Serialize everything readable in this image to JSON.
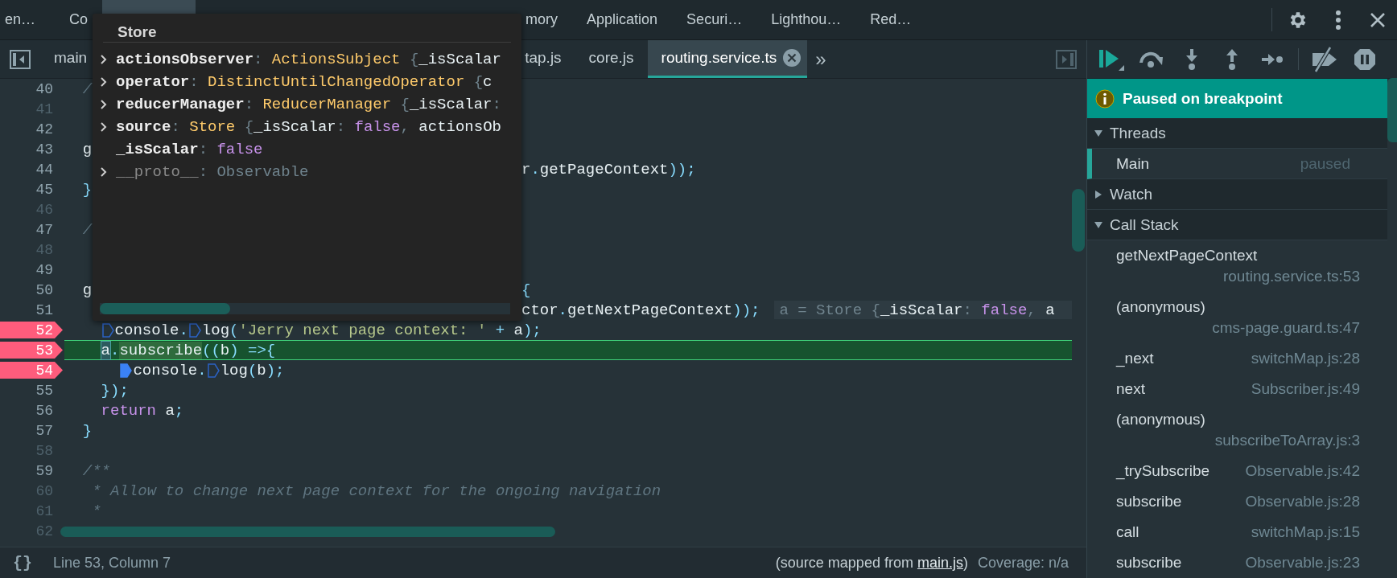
{
  "panel_tabs": [
    {
      "label": "en…",
      "selected": false
    },
    {
      "label": "Co",
      "selected": false
    },
    {
      "selected": true
    },
    {
      "label": "mory",
      "selected": false
    },
    {
      "label": "Application",
      "selected": false
    },
    {
      "label": "Securi…",
      "selected": false
    },
    {
      "label": "Lighthou…",
      "selected": false
    },
    {
      "label": "Red…",
      "selected": false
    }
  ],
  "file_tabs": [
    {
      "label": "main",
      "selected": false
    },
    {
      "label": "tap.js",
      "selected": false
    },
    {
      "label": "core.js",
      "selected": false
    },
    {
      "label": "routing.service.ts",
      "selected": true
    }
  ],
  "more_tabs": "»",
  "hover_popup": {
    "title": "Store",
    "properties": [
      {
        "name": "actionsObserver",
        "expandable": true,
        "dim": false,
        "value": [
          {
            "text": ": ",
            "kind": "muted"
          },
          {
            "text": "ActionsSubject",
            "kind": "class"
          },
          {
            "text": " {",
            "kind": "muted"
          },
          {
            "text": "_isScalar",
            "kind": "plain"
          }
        ]
      },
      {
        "name": "operator",
        "expandable": true,
        "dim": false,
        "value": [
          {
            "text": ": ",
            "kind": "muted"
          },
          {
            "text": "DistinctUntilChangedOperator",
            "kind": "class"
          },
          {
            "text": " {",
            "kind": "muted"
          },
          {
            "text": "c",
            "kind": "plain"
          }
        ]
      },
      {
        "name": "reducerManager",
        "expandable": true,
        "dim": false,
        "value": [
          {
            "text": ": ",
            "kind": "muted"
          },
          {
            "text": "ReducerManager",
            "kind": "class"
          },
          {
            "text": " {",
            "kind": "muted"
          },
          {
            "text": "_isScalar",
            "kind": "plain"
          },
          {
            "text": ":",
            "kind": "muted"
          }
        ]
      },
      {
        "name": "source",
        "expandable": true,
        "dim": false,
        "value": [
          {
            "text": ": ",
            "kind": "muted"
          },
          {
            "text": "Store",
            "kind": "class"
          },
          {
            "text": " {",
            "kind": "muted"
          },
          {
            "text": "_isScalar",
            "kind": "plain"
          },
          {
            "text": ": ",
            "kind": "muted"
          },
          {
            "text": "false",
            "kind": "bool"
          },
          {
            "text": ", ",
            "kind": "muted"
          },
          {
            "text": "actionsOb",
            "kind": "plain"
          }
        ]
      },
      {
        "name": "_isScalar",
        "expandable": false,
        "dim": false,
        "value": [
          {
            "text": ": ",
            "kind": "muted"
          },
          {
            "text": "false",
            "kind": "bool"
          }
        ]
      },
      {
        "name": "__proto__",
        "expandable": true,
        "dim": true,
        "value": [
          {
            "text": ": ",
            "kind": "muted"
          },
          {
            "text": "Observable",
            "kind": "muted"
          }
        ]
      }
    ]
  },
  "lines": [
    {
      "number": "40",
      "dim": false,
      "breakpoint": false,
      "current": false,
      "code": [
        {
          "text": "  /",
          "kind": "comment"
        }
      ]
    },
    {
      "number": "41",
      "dim": true,
      "breakpoint": false,
      "current": false
    },
    {
      "number": "42",
      "dim": false,
      "breakpoint": false,
      "current": false
    },
    {
      "number": "43",
      "dim": false,
      "breakpoint": false,
      "current": false,
      "code": [
        {
          "text": "  g",
          "kind": "plain"
        }
      ]
    },
    {
      "number": "44",
      "dim": false,
      "breakpoint": false,
      "current": false,
      "code_after": [
        {
          "text": "r",
          "kind": "plain"
        },
        {
          "text": ".",
          "kind": "punct"
        },
        {
          "text": "getPageContext",
          "kind": "plain"
        },
        {
          "text": "));",
          "kind": "punct"
        }
      ]
    },
    {
      "number": "45",
      "dim": false,
      "breakpoint": false,
      "current": false,
      "code": [
        {
          "text": "  }",
          "kind": "punct"
        }
      ]
    },
    {
      "number": "46",
      "dim": true,
      "breakpoint": false,
      "current": false
    },
    {
      "number": "47",
      "dim": false,
      "breakpoint": false,
      "current": false,
      "code": [
        {
          "text": "  /",
          "kind": "comment"
        }
      ]
    },
    {
      "number": "48",
      "dim": true,
      "breakpoint": false,
      "current": false
    },
    {
      "number": "49",
      "dim": false,
      "breakpoint": false,
      "current": false
    },
    {
      "number": "50",
      "dim": false,
      "breakpoint": false,
      "current": false,
      "code": [
        {
          "text": "  g",
          "kind": "plain"
        }
      ],
      "code_after": [
        {
          "text": "{",
          "kind": "punct"
        }
      ]
    },
    {
      "number": "51",
      "dim": false,
      "breakpoint": false,
      "current": false,
      "code_after": [
        {
          "text": "ctor",
          "kind": "plain"
        },
        {
          "text": ".",
          "kind": "punct"
        },
        {
          "text": "getNextPageContext",
          "kind": "plain"
        },
        {
          "text": "));",
          "kind": "punct"
        }
      ],
      "inline_value": [
        {
          "text": "a = Store {",
          "kind": "muted"
        },
        {
          "text": "_isScalar",
          "kind": "plain"
        },
        {
          "text": ": ",
          "kind": "muted"
        },
        {
          "text": "false",
          "kind": "bool"
        },
        {
          "text": ", ",
          "kind": "muted"
        },
        {
          "text": "a",
          "kind": "plain"
        }
      ]
    },
    {
      "number": "52",
      "dim": false,
      "breakpoint": true,
      "current": false,
      "code": [
        {
          "text": "    console",
          "kind": "plain",
          "marker_active": false
        },
        {
          "text": ".",
          "kind": "punct"
        },
        {
          "text": "log",
          "kind": "plain",
          "marker_active": false
        },
        {
          "text": "(",
          "kind": "punct"
        },
        {
          "text": "'Jerry next page context: '",
          "kind": "string"
        },
        {
          "text": " + ",
          "kind": "punct"
        },
        {
          "text": "a",
          "kind": "plain"
        },
        {
          "text": ");",
          "kind": "punct"
        }
      ]
    },
    {
      "number": "53",
      "dim": false,
      "breakpoint": true,
      "current": true,
      "code": [
        {
          "text": "    a",
          "kind": "plain",
          "cursor": true
        },
        {
          "text": ".",
          "kind": "punct"
        },
        {
          "text": "subscribe",
          "kind": "plain",
          "highlighted": true
        },
        {
          "text": "((",
          "kind": "punct"
        },
        {
          "text": "b",
          "kind": "plain"
        },
        {
          "text": ") =>{",
          "kind": "punct"
        }
      ]
    },
    {
      "number": "54",
      "dim": false,
      "breakpoint": true,
      "current": false,
      "code": [
        {
          "text": "      console",
          "kind": "plain",
          "marker_active": true
        },
        {
          "text": ".",
          "kind": "punct"
        },
        {
          "text": "log",
          "kind": "plain",
          "marker_active": false
        },
        {
          "text": "(",
          "kind": "punct"
        },
        {
          "text": "b",
          "kind": "plain"
        },
        {
          "text": ");",
          "kind": "punct"
        }
      ]
    },
    {
      "number": "55",
      "dim": false,
      "breakpoint": false,
      "current": false,
      "code": [
        {
          "text": "    });",
          "kind": "punct"
        }
      ]
    },
    {
      "number": "56",
      "dim": false,
      "breakpoint": false,
      "current": false,
      "code": [
        {
          "text": "    return",
          "kind": "keyword"
        },
        {
          "text": " a",
          "kind": "plain"
        },
        {
          "text": ";",
          "kind": "punct"
        }
      ]
    },
    {
      "number": "57",
      "dim": false,
      "breakpoint": false,
      "current": false,
      "code": [
        {
          "text": "  }",
          "kind": "punct"
        }
      ]
    },
    {
      "number": "58",
      "dim": true,
      "breakpoint": false,
      "current": false
    },
    {
      "number": "59",
      "dim": false,
      "breakpoint": false,
      "current": false,
      "code": [
        {
          "text": "  /**",
          "kind": "comment"
        }
      ]
    },
    {
      "number": "60",
      "dim": true,
      "breakpoint": false,
      "current": false,
      "code": [
        {
          "text": "   * Allow to change next page context for the ongoing navigation",
          "kind": "comment"
        }
      ]
    },
    {
      "number": "61",
      "dim": true,
      "breakpoint": false,
      "current": false,
      "code": [
        {
          "text": "   *",
          "kind": "comment"
        }
      ]
    },
    {
      "number": "62",
      "dim": true,
      "breakpoint": false,
      "current": false
    }
  ],
  "status_bar": {
    "pretty_print": "{}",
    "position": "Line 53, Column 7",
    "source_prefix": "(source mapped from ",
    "source_link": "main.js",
    "source_suffix": ")",
    "coverage": "Coverage: n/a"
  },
  "debugger": {
    "banner": "Paused on breakpoint",
    "threads": {
      "title": "Threads",
      "expanded": true,
      "items": [
        {
          "name": "Main",
          "status": "paused",
          "selected": true
        }
      ]
    },
    "watch": {
      "title": "Watch",
      "expanded": false
    },
    "call_stack": {
      "title": "Call Stack",
      "expanded": true,
      "frames": [
        {
          "name": "getNextPageContext",
          "location": "routing.service.ts:53"
        },
        {
          "name": "(anonymous)",
          "location": "cms-page.guard.ts:47"
        },
        {
          "name": "_next",
          "location": "switchMap.js:28"
        },
        {
          "name": "next",
          "location": "Subscriber.js:49"
        },
        {
          "name": "(anonymous)",
          "location": "subscribeToArray.js:3"
        },
        {
          "name": "_trySubscribe",
          "location": "Observable.js:42"
        },
        {
          "name": "subscribe",
          "location": "Observable.js:28"
        },
        {
          "name": "call",
          "location": "switchMap.js:15"
        },
        {
          "name": "subscribe",
          "location": "Observable.js:23"
        }
      ]
    }
  }
}
